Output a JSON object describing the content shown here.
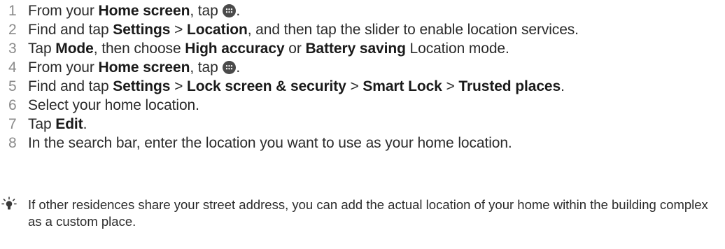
{
  "steps": [
    {
      "number": "1",
      "parts": [
        {
          "t": "From your ",
          "b": false
        },
        {
          "t": "Home screen",
          "b": true
        },
        {
          "t": ", tap ",
          "b": false
        },
        {
          "icon": "apps-icon"
        },
        {
          "t": ".",
          "b": false
        }
      ]
    },
    {
      "number": "2",
      "parts": [
        {
          "t": "Find and tap ",
          "b": false
        },
        {
          "t": "Settings",
          "b": true
        },
        {
          "t": " > ",
          "b": false
        },
        {
          "t": "Location",
          "b": true
        },
        {
          "t": ", and then tap the slider to enable location services.",
          "b": false
        }
      ]
    },
    {
      "number": "3",
      "parts": [
        {
          "t": "Tap ",
          "b": false
        },
        {
          "t": "Mode",
          "b": true
        },
        {
          "t": ", then choose ",
          "b": false
        },
        {
          "t": "High accuracy",
          "b": true
        },
        {
          "t": " or ",
          "b": false
        },
        {
          "t": "Battery saving",
          "b": true
        },
        {
          "t": " Location mode.",
          "b": false
        }
      ]
    },
    {
      "number": "4",
      "parts": [
        {
          "t": "From your ",
          "b": false
        },
        {
          "t": "Home screen",
          "b": true
        },
        {
          "t": ", tap ",
          "b": false
        },
        {
          "icon": "apps-icon"
        },
        {
          "t": ".",
          "b": false
        }
      ]
    },
    {
      "number": "5",
      "parts": [
        {
          "t": "Find and tap ",
          "b": false
        },
        {
          "t": "Settings",
          "b": true
        },
        {
          "t": " > ",
          "b": false
        },
        {
          "t": "Lock screen & security",
          "b": true
        },
        {
          "t": " > ",
          "b": false
        },
        {
          "t": "Smart Lock",
          "b": true
        },
        {
          "t": " > ",
          "b": false
        },
        {
          "t": "Trusted places",
          "b": true
        },
        {
          "t": ".",
          "b": false
        }
      ]
    },
    {
      "number": "6",
      "parts": [
        {
          "t": "Select your home location.",
          "b": false
        }
      ]
    },
    {
      "number": "7",
      "parts": [
        {
          "t": "Tap ",
          "b": false
        },
        {
          "t": "Edit",
          "b": true
        },
        {
          "t": ".",
          "b": false
        }
      ]
    },
    {
      "number": "8",
      "parts": [
        {
          "t": "In the search bar, enter the location you want to use as your home location.",
          "b": false
        }
      ]
    }
  ],
  "tip": {
    "icon": "lightbulb-icon",
    "text": "If other residences share your street address, you can add the actual location of your home within the building complex as a custom place."
  }
}
